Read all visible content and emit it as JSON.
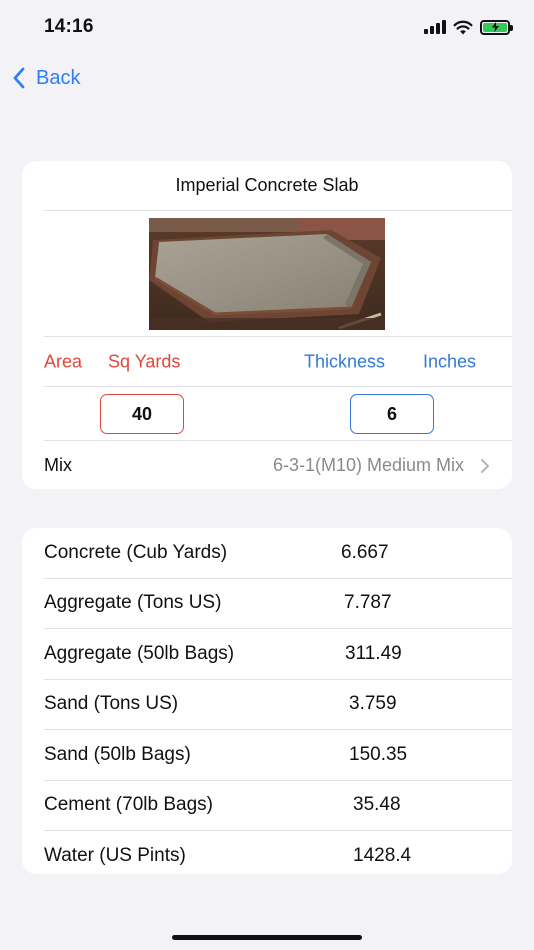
{
  "status_bar": {
    "time": "14:16"
  },
  "nav": {
    "back_label": "Back"
  },
  "calculator": {
    "title": "Imperial Concrete Slab",
    "area_label": "Area",
    "area_unit": "Sq Yards",
    "thickness_label": "Thickness",
    "thickness_unit": "Inches",
    "area_value": "40",
    "thickness_value": "6",
    "mix_label": "Mix",
    "mix_value": "6-3-1(M10) Medium Mix"
  },
  "results": [
    {
      "name": "Concrete (Cub Yards)",
      "value": "6.667"
    },
    {
      "name": "Aggregate (Tons US)",
      "value": "7.787"
    },
    {
      "name": "Aggregate (50lb Bags)",
      "value": "311.49"
    },
    {
      "name": "Sand (Tons US)",
      "value": "3.759"
    },
    {
      "name": "Sand (50lb Bags)",
      "value": "150.35"
    },
    {
      "name": "Cement (70lb Bags)",
      "value": "35.48"
    },
    {
      "name": "Water (US Pints)",
      "value": "1428.4"
    }
  ],
  "colors": {
    "accent_blue": "#3478d8",
    "accent_red": "#e0483a",
    "background": "#f2f2f7",
    "battery": "#34c759"
  },
  "icons": [
    "signal-icon",
    "wifi-icon",
    "battery-charging-icon",
    "chevron-left-icon",
    "chevron-right-icon"
  ]
}
